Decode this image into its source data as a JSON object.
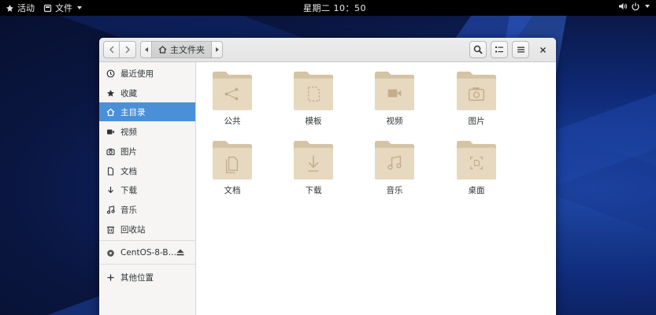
{
  "topbar": {
    "activities": "活动",
    "app_menu": "文件",
    "clock": "星期二 10：50"
  },
  "window": {
    "path_label": "主文件夹"
  },
  "sidebar": {
    "items": [
      {
        "label": "最近使用",
        "icon": "clock-icon"
      },
      {
        "label": "收藏",
        "icon": "star-icon"
      },
      {
        "label": "主目录",
        "icon": "home-icon",
        "selected": true
      },
      {
        "label": "视频",
        "icon": "video-icon"
      },
      {
        "label": "图片",
        "icon": "camera-icon"
      },
      {
        "label": "文档",
        "icon": "document-icon"
      },
      {
        "label": "下载",
        "icon": "download-icon"
      },
      {
        "label": "音乐",
        "icon": "music-icon"
      },
      {
        "label": "回收站",
        "icon": "trash-icon"
      }
    ],
    "device": {
      "label": "CentOS-8-B…",
      "icon": "disc-icon"
    },
    "other": {
      "label": "其他位置",
      "icon": "plus-icon"
    }
  },
  "files": [
    {
      "label": "公共",
      "icon": "share-icon"
    },
    {
      "label": "模板",
      "icon": "template-icon"
    },
    {
      "label": "视频",
      "icon": "video-icon"
    },
    {
      "label": "图片",
      "icon": "camera-icon"
    },
    {
      "label": "文档",
      "icon": "documents-icon"
    },
    {
      "label": "下载",
      "icon": "download-icon"
    },
    {
      "label": "音乐",
      "icon": "music-icon"
    },
    {
      "label": "桌面",
      "icon": "desktop-icon"
    }
  ],
  "colors": {
    "accent": "#4a90d9",
    "folder_body": "#e6d9c0",
    "folder_tab": "#d4c4a4",
    "folder_glyph": "#c3ae8a"
  }
}
